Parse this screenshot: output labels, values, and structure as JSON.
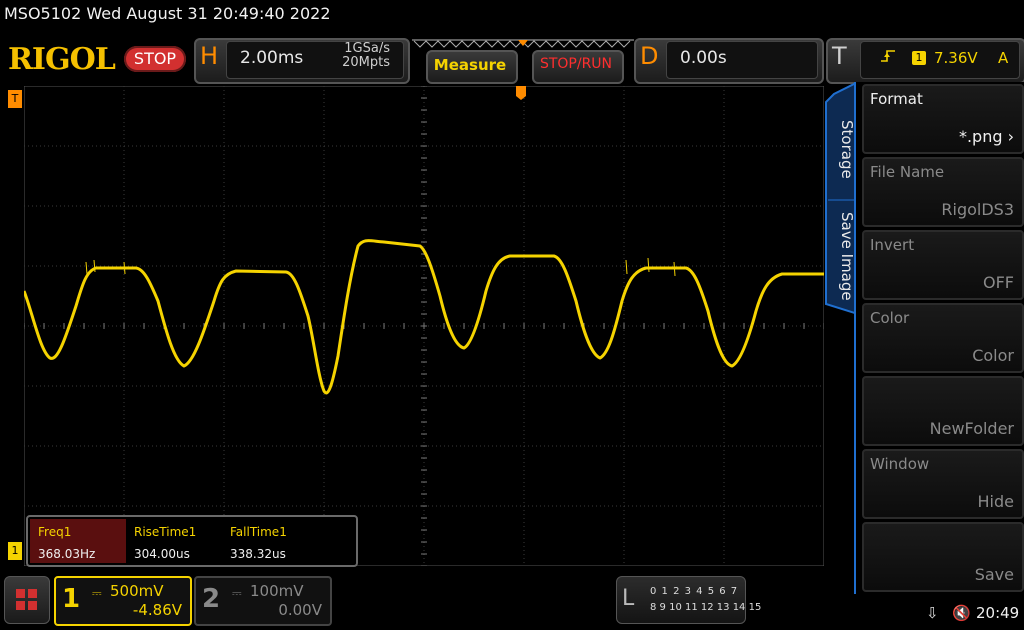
{
  "status_bar": {
    "title": "MSO5102  Wed August 31 20:49:40 2022"
  },
  "header": {
    "logo_text": "RIGOL",
    "run_state": "STOP",
    "horizontal": {
      "letter": "H",
      "timebase": "2.00ms",
      "sample_rate": "1GSa/s",
      "memory_depth": "20Mpts"
    },
    "measure_button": "Measure",
    "stoprun_button": "STOP/RUN",
    "delay": {
      "letter": "D",
      "value": "0.00s"
    },
    "trigger": {
      "letter": "T",
      "edge_icon": "rising-edge-icon",
      "source": "1",
      "level": "7.36V",
      "mode": "A"
    }
  },
  "waveform": {
    "channel_marker": "1",
    "trigger_position_marker": "T",
    "color": "#f5d300",
    "grid_divisions": {
      "x": 8,
      "y": 8
    }
  },
  "measurements": [
    {
      "name": "Freq1",
      "value": "368.03Hz",
      "selected": true
    },
    {
      "name": "RiseTime1",
      "value": "304.00us",
      "selected": false
    },
    {
      "name": "FallTime1",
      "value": "338.32us",
      "selected": false
    }
  ],
  "side_menu": {
    "tab_storage": "Storage",
    "tab_save_image": "Save Image",
    "items": [
      {
        "title": "Format",
        "value": "*.png",
        "enabled": true
      },
      {
        "title": "File Name",
        "value": "RigolDS3",
        "enabled": false
      },
      {
        "title": "Invert",
        "value": "OFF",
        "enabled": false
      },
      {
        "title": "Color",
        "value": "Color",
        "enabled": false
      },
      {
        "title": "",
        "value": "NewFolder",
        "enabled": false
      },
      {
        "title": "Window",
        "value": "Hide",
        "enabled": false
      },
      {
        "title": "",
        "value": "Save",
        "enabled": false
      }
    ]
  },
  "bottom_bar": {
    "ch1": {
      "number": "1",
      "scale": "500mV",
      "offset": "-4.86V"
    },
    "ch2": {
      "number": "2",
      "scale": "100mV",
      "offset": "0.00V"
    },
    "logic": {
      "letter": "L",
      "row1": "0 1 2 3  4 5 6 7",
      "row2": "8 9 10 11 12 13 14 15"
    },
    "time": "20:49"
  }
}
